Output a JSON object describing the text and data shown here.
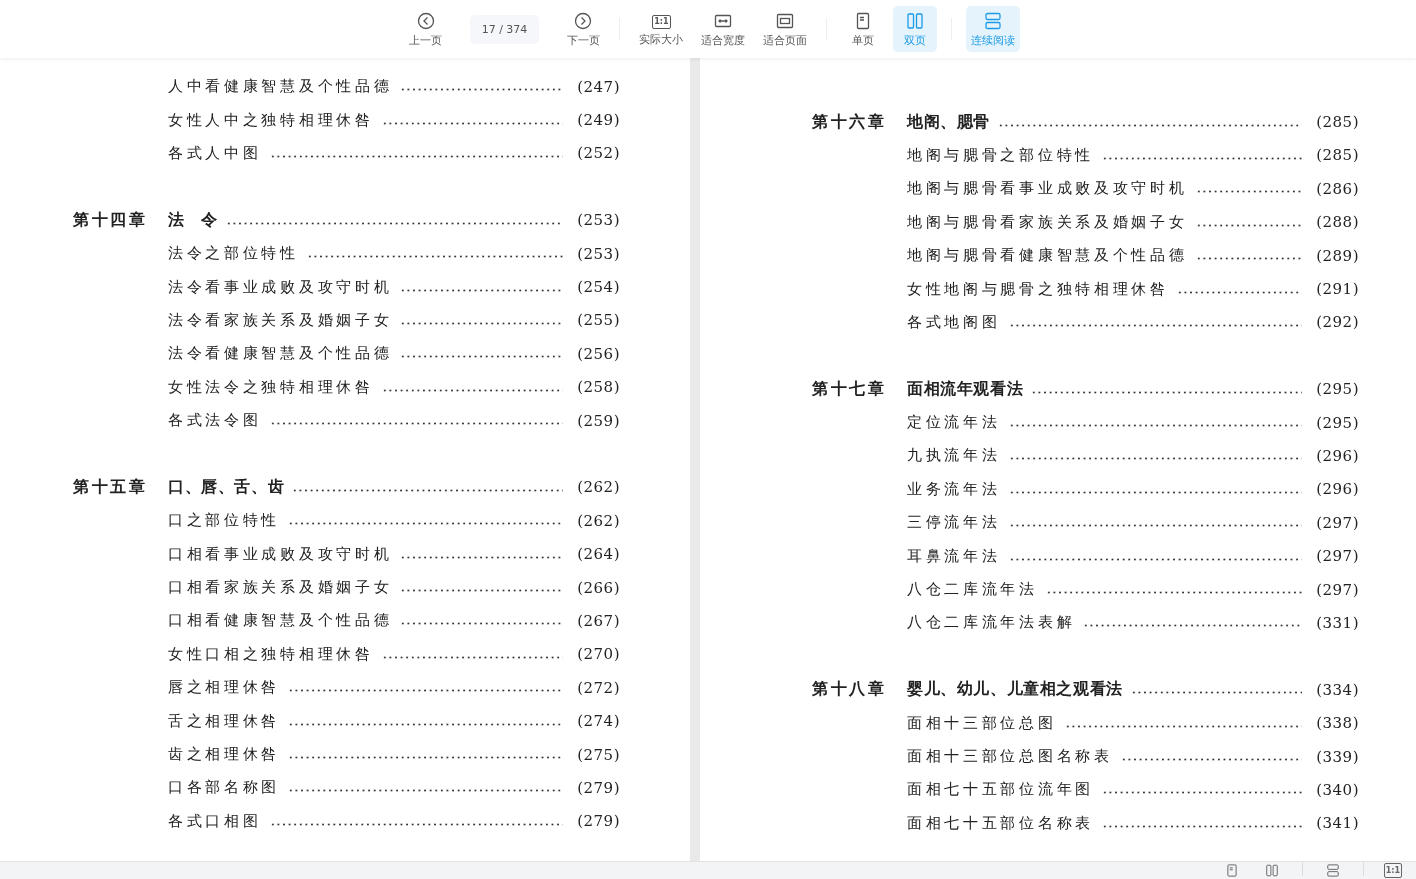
{
  "toolbar": {
    "items": [
      {
        "kind": "prev",
        "label": "上一页",
        "selected": false
      },
      {
        "kind": "pager",
        "current": "17",
        "separator": "/",
        "total": "374"
      },
      {
        "kind": "next",
        "label": "下一页",
        "selected": false
      },
      {
        "kind": "separator"
      },
      {
        "kind": "actual-size",
        "label": "实际大小",
        "icon_text": "1:1",
        "selected": false
      },
      {
        "kind": "fit-width",
        "label": "适合宽度",
        "selected": false
      },
      {
        "kind": "fit-page",
        "label": "适合页面",
        "selected": false
      },
      {
        "kind": "separator"
      },
      {
        "kind": "single",
        "label": "单页",
        "selected": false
      },
      {
        "kind": "double",
        "label": "双页",
        "selected": true
      },
      {
        "kind": "separator"
      },
      {
        "kind": "continuous",
        "label": "连续阅读",
        "selected": true
      }
    ]
  },
  "pages": [
    {
      "entries": [
        {
          "kind": "section",
          "title": "人中看健康智慧及个性品德",
          "page": "(247)"
        },
        {
          "kind": "section",
          "title": "女性人中之独特相理休咎",
          "page": "(249)"
        },
        {
          "kind": "section",
          "title": "各式人中图",
          "page": "(252)"
        },
        {
          "kind": "chapter",
          "chapter": "第十四章",
          "title": "法　令",
          "page": "(253)"
        },
        {
          "kind": "section",
          "title": "法令之部位特性",
          "page": "(253)"
        },
        {
          "kind": "section",
          "title": "法令看事业成败及攻守时机",
          "page": "(254)"
        },
        {
          "kind": "section",
          "title": "法令看家族关系及婚姻子女",
          "page": "(255)"
        },
        {
          "kind": "section",
          "title": "法令看健康智慧及个性品德",
          "page": "(256)"
        },
        {
          "kind": "section",
          "title": "女性法令之独特相理休咎",
          "page": "(258)"
        },
        {
          "kind": "section",
          "title": "各式法令图",
          "page": "(259)"
        },
        {
          "kind": "chapter",
          "chapter": "第十五章",
          "title": "口、唇、舌、齿",
          "page": "(262)"
        },
        {
          "kind": "section",
          "title": "口之部位特性",
          "page": "(262)"
        },
        {
          "kind": "section",
          "title": "口相看事业成败及攻守时机",
          "page": "(264)"
        },
        {
          "kind": "section",
          "title": "口相看家族关系及婚姻子女",
          "page": "(266)"
        },
        {
          "kind": "section",
          "title": "口相看健康智慧及个性品德",
          "page": "(267)"
        },
        {
          "kind": "section",
          "title": "女性口相之独特相理休咎",
          "page": "(270)"
        },
        {
          "kind": "section",
          "title": "唇之相理休咎",
          "page": "(272)"
        },
        {
          "kind": "section",
          "title": "舌之相理休咎",
          "page": "(274)"
        },
        {
          "kind": "section",
          "title": "齿之相理休咎",
          "page": "(275)"
        },
        {
          "kind": "section",
          "title": "口各部名称图",
          "page": "(279)"
        },
        {
          "kind": "section",
          "title": "各式口相图",
          "page": "(279)"
        }
      ]
    },
    {
      "entries": [
        {
          "kind": "chapter",
          "chapter": "第十六章",
          "title": "地阁、腮骨",
          "page": "(285)"
        },
        {
          "kind": "section",
          "title": "地阁与腮骨之部位特性",
          "page": "(285)"
        },
        {
          "kind": "section",
          "title": "地阁与腮骨看事业成败及攻守时机",
          "page": "(286)"
        },
        {
          "kind": "section",
          "title": "地阁与腮骨看家族关系及婚姻子女",
          "page": "(288)"
        },
        {
          "kind": "section",
          "title": "地阁与腮骨看健康智慧及个性品德",
          "page": "(289)"
        },
        {
          "kind": "section",
          "title": "女性地阁与腮骨之独特相理休咎",
          "page": "(291)"
        },
        {
          "kind": "section",
          "title": "各式地阁图",
          "page": "(292)"
        },
        {
          "kind": "chapter",
          "chapter": "第十七章",
          "title": "面相流年观看法",
          "page": "(295)"
        },
        {
          "kind": "section",
          "title": "定位流年法",
          "page": "(295)"
        },
        {
          "kind": "section",
          "title": "九执流年法",
          "page": "(296)"
        },
        {
          "kind": "section",
          "title": "业务流年法",
          "page": "(296)"
        },
        {
          "kind": "section",
          "title": "三停流年法",
          "page": "(297)"
        },
        {
          "kind": "section",
          "title": "耳鼻流年法",
          "page": "(297)"
        },
        {
          "kind": "section",
          "title": "八仓二库流年法",
          "page": "(297)"
        },
        {
          "kind": "section",
          "title": "八仓二库流年法表解",
          "page": "(331)"
        },
        {
          "kind": "chapter",
          "chapter": "第十八章",
          "title": "婴儿、幼儿、儿童相之观看法",
          "page": "(334)"
        },
        {
          "kind": "section",
          "title": "面相十三部位总图",
          "page": "(338)"
        },
        {
          "kind": "section",
          "title": "面相十三部位总图名称表",
          "page": "(339)"
        },
        {
          "kind": "section",
          "title": "面相七十五部位流年图",
          "page": "(340)"
        },
        {
          "kind": "section",
          "title": "面相七十五部位名称表",
          "page": "(341)"
        }
      ]
    }
  ],
  "bottom_bar": {
    "items": [
      {
        "kind": "single"
      },
      {
        "kind": "double"
      },
      {
        "kind": "separator"
      },
      {
        "kind": "continuous"
      },
      {
        "kind": "separator"
      },
      {
        "kind": "actual-size",
        "icon_text": "1:1"
      }
    ]
  }
}
